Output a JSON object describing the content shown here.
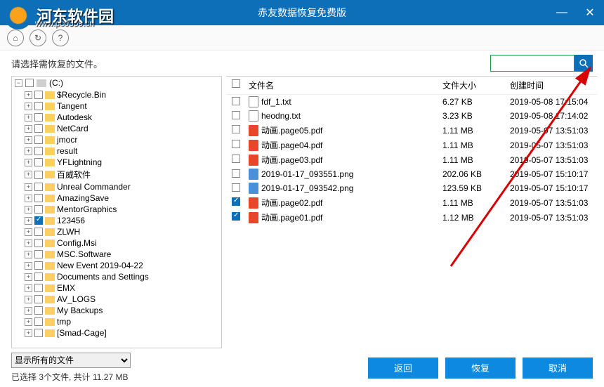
{
  "window": {
    "title": "赤友数据恢复免费版",
    "logo_text": "河东软件园",
    "logo_url": "www.pc0359.cn"
  },
  "instruction": "请选择需恢复的文件。",
  "search": {
    "placeholder": ""
  },
  "tree": {
    "root": "(C:)",
    "items": [
      {
        "label": "$Recycle.Bin",
        "checked": false
      },
      {
        "label": "Tangent",
        "checked": false
      },
      {
        "label": "Autodesk",
        "checked": false
      },
      {
        "label": "NetCard",
        "checked": false
      },
      {
        "label": "jmocr",
        "checked": false
      },
      {
        "label": "result",
        "checked": false
      },
      {
        "label": "YFLightning",
        "checked": false
      },
      {
        "label": "百威软件",
        "checked": false
      },
      {
        "label": "Unreal Commander",
        "checked": false
      },
      {
        "label": "AmazingSave",
        "checked": false
      },
      {
        "label": "MentorGraphics",
        "checked": false
      },
      {
        "label": "123456",
        "checked": true
      },
      {
        "label": "ZLWH",
        "checked": false
      },
      {
        "label": "Config.Msi",
        "checked": false
      },
      {
        "label": "MSC.Software",
        "checked": false
      },
      {
        "label": "New Event 2019-04-22",
        "checked": false
      },
      {
        "label": "Documents and Settings",
        "checked": false
      },
      {
        "label": "EMX",
        "checked": false
      },
      {
        "label": "AV_LOGS",
        "checked": false
      },
      {
        "label": "My Backups",
        "checked": false
      },
      {
        "label": "tmp",
        "checked": false
      },
      {
        "label": "[Smad-Cage]",
        "checked": false
      }
    ]
  },
  "files": {
    "headers": {
      "name": "文件名",
      "size": "文件大小",
      "time": "创建时间"
    },
    "rows": [
      {
        "name": "fdf_1.txt",
        "size": "6.27 KB",
        "time": "2019-05-08 17:15:04",
        "type": "txt",
        "checked": false
      },
      {
        "name": "heodng.txt",
        "size": "3.23 KB",
        "time": "2019-05-08 17:14:02",
        "type": "txt",
        "checked": false
      },
      {
        "name": "动画.page05.pdf",
        "size": "1.11 MB",
        "time": "2019-05-07 13:51:03",
        "type": "pdf",
        "checked": false
      },
      {
        "name": "动画.page04.pdf",
        "size": "1.11 MB",
        "time": "2019-05-07 13:51:03",
        "type": "pdf",
        "checked": false
      },
      {
        "name": "动画.page03.pdf",
        "size": "1.11 MB",
        "time": "2019-05-07 13:51:03",
        "type": "pdf",
        "checked": false
      },
      {
        "name": "2019-01-17_093551.png",
        "size": "202.06 KB",
        "time": "2019-05-07 15:10:17",
        "type": "img",
        "checked": false
      },
      {
        "name": "2019-01-17_093542.png",
        "size": "123.59 KB",
        "time": "2019-05-07 15:10:17",
        "type": "img",
        "checked": false
      },
      {
        "name": "动画.page02.pdf",
        "size": "1.11 MB",
        "time": "2019-05-07 13:51:03",
        "type": "pdf",
        "checked": true
      },
      {
        "name": "动画.page01.pdf",
        "size": "1.12 MB",
        "time": "2019-05-07 13:51:03",
        "type": "pdf",
        "checked": true
      }
    ]
  },
  "filter": {
    "selected": "显示所有的文件"
  },
  "status": "已选择 3个文件, 共计 11.27 MB",
  "buttons": {
    "back": "返回",
    "recover": "恢复",
    "cancel": "取消"
  }
}
